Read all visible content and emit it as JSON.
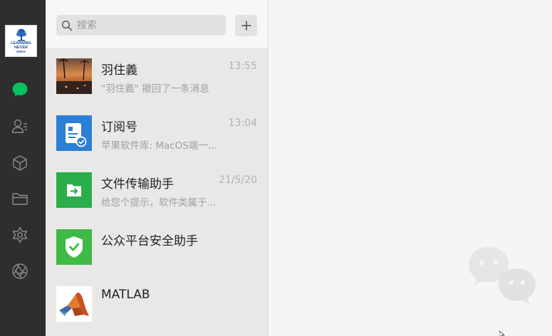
{
  "user": {
    "avatar_lines": [
      "LEARNING",
      "NEVER",
      "ENDS"
    ]
  },
  "rail": {
    "items": [
      {
        "name": "chats",
        "icon": "chat-bubble-icon",
        "active": true
      },
      {
        "name": "contacts",
        "icon": "contacts-icon"
      },
      {
        "name": "collections",
        "icon": "cube-icon"
      },
      {
        "name": "files",
        "icon": "folder-icon"
      },
      {
        "name": "moments",
        "icon": "moments-icon"
      },
      {
        "name": "channels",
        "icon": "aperture-icon"
      }
    ]
  },
  "search": {
    "placeholder": "搜索"
  },
  "add_button_icon": "plus-icon",
  "chats": [
    {
      "name": "羽住義",
      "time": "13:55",
      "preview": "\"羽住義\" 撤回了一条消息",
      "avatar": "sunset-photo"
    },
    {
      "name": "订阅号",
      "time": "13:04",
      "preview": "苹果软件库: MacOS端一...",
      "avatar": "subscription-icon"
    },
    {
      "name": "文件传输助手",
      "time": "21/5/20",
      "preview": "给您个提示，软件类属于...",
      "avatar": "file-transfer-icon"
    },
    {
      "name": "公众平台安全助手",
      "time": "",
      "preview": "",
      "avatar": "shield-check-icon"
    },
    {
      "name": "MATLAB",
      "time": "",
      "preview": "",
      "avatar": "matlab-logo"
    }
  ],
  "colors": {
    "rail_bg": "#2e2e2e",
    "active_green": "#07c160",
    "list_bg": "#e9e8e7",
    "chat_bg": "#f5f5f5"
  }
}
